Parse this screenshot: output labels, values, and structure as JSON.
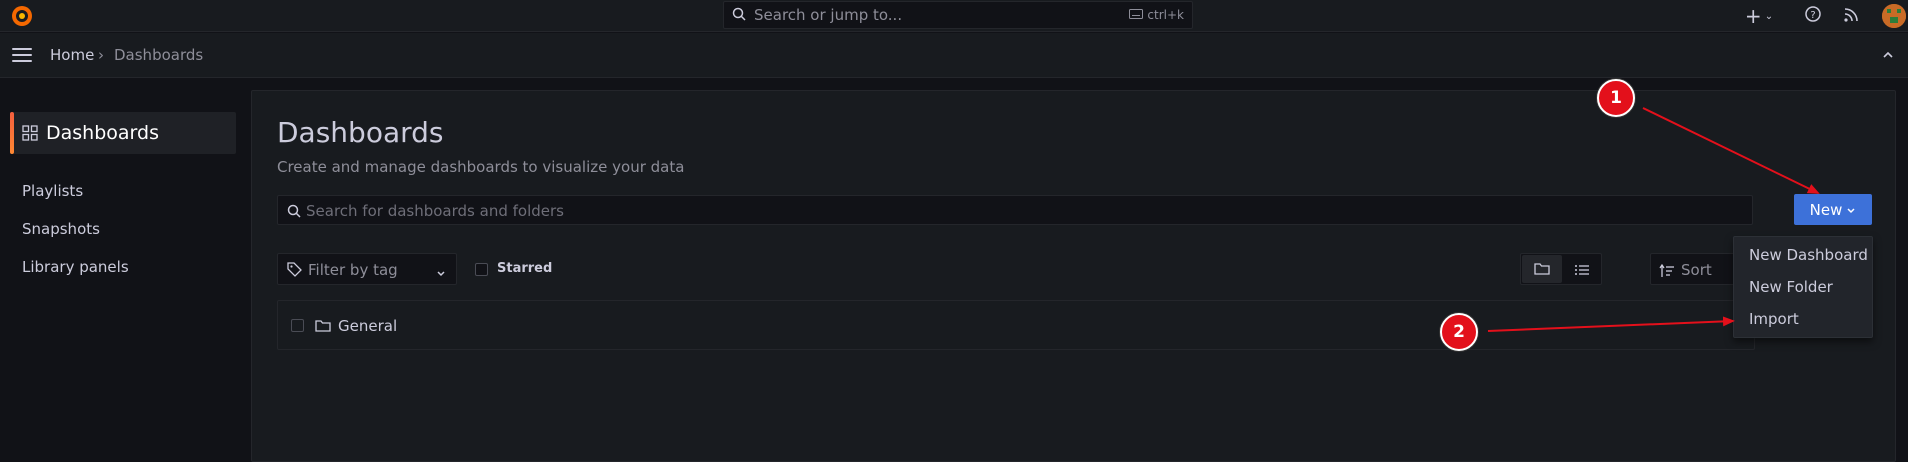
{
  "topbar": {
    "search_placeholder": "Search or jump to...",
    "shortcut": "ctrl+k"
  },
  "breadcrumb": {
    "home": "Home",
    "separator": "›",
    "current": "Dashboards"
  },
  "sidebar": {
    "active": "Dashboards",
    "items": [
      "Playlists",
      "Snapshots",
      "Library panels"
    ]
  },
  "main": {
    "title": "Dashboards",
    "subtitle": "Create and manage dashboards to visualize your data",
    "search_placeholder": "Search for dashboards and folders",
    "new_button": "New",
    "filter_placeholder": "Filter by tag",
    "starred_label": "Starred",
    "sort_placeholder": "Sort",
    "folders": [
      "General"
    ]
  },
  "new_menu": {
    "items": [
      "New Dashboard",
      "New Folder",
      "Import"
    ]
  },
  "annotations": {
    "step1": "1",
    "step2": "2"
  },
  "colors": {
    "accent": "#3d71d9",
    "annotation": "#e3101b",
    "active_bar": "#f55f3e"
  }
}
